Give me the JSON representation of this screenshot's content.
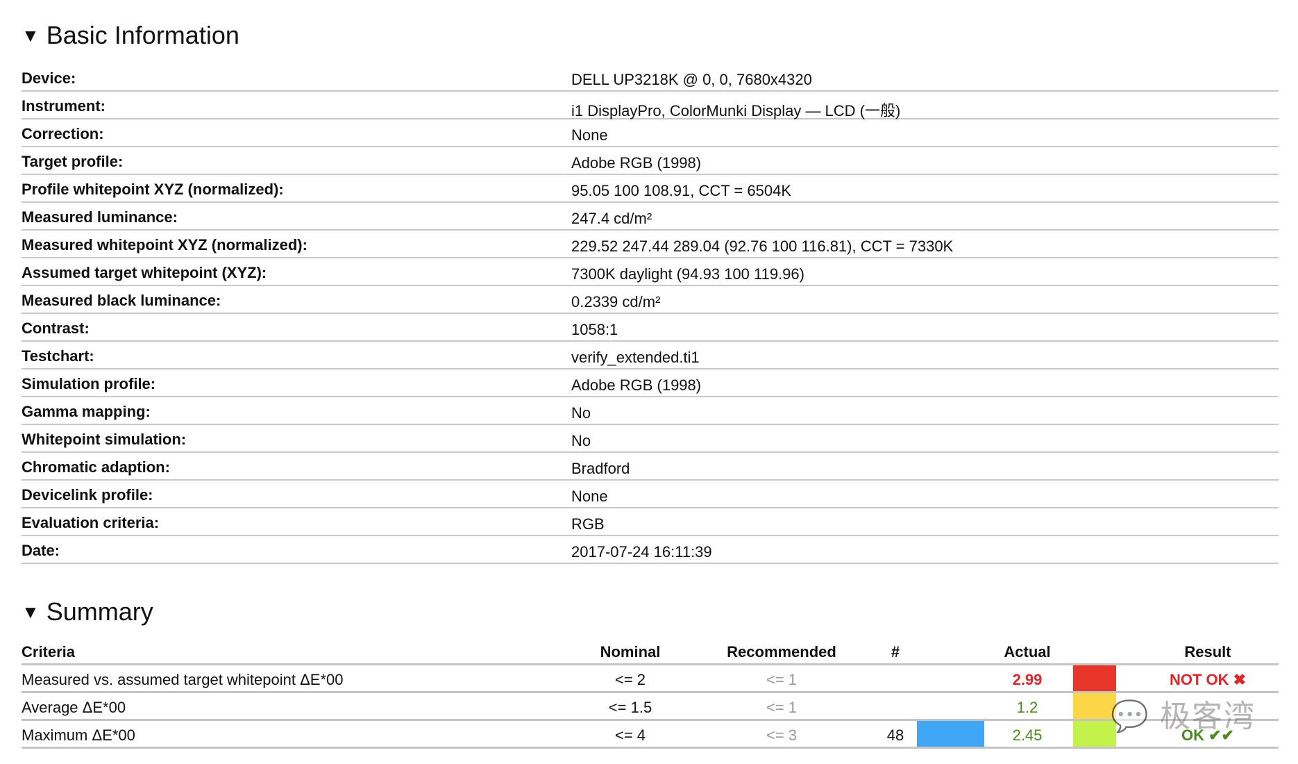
{
  "basic": {
    "title": "Basic Information",
    "rows": [
      {
        "label": "Device:",
        "value": "DELL UP3218K @ 0, 0, 7680x4320"
      },
      {
        "label": "Instrument:",
        "value": "i1 DisplayPro, ColorMunki Display — LCD (一般)"
      },
      {
        "label": "Correction:",
        "value": "None"
      },
      {
        "label": "Target profile:",
        "value": "Adobe RGB (1998)"
      },
      {
        "label": "Profile whitepoint XYZ (normalized):",
        "value": "95.05 100 108.91, CCT = 6504K"
      },
      {
        "label": "Measured luminance:",
        "value": "247.4 cd/m²"
      },
      {
        "label": "Measured whitepoint XYZ (normalized):",
        "value": "229.52 247.44 289.04 (92.76 100 116.81), CCT = 7330K"
      },
      {
        "label": "Assumed target whitepoint (XYZ):",
        "value": "7300K daylight (94.93 100 119.96)"
      },
      {
        "label": "Measured black luminance:",
        "value": "0.2339 cd/m²"
      },
      {
        "label": "Contrast:",
        "value": "1058:1"
      },
      {
        "label": "Testchart:",
        "value": "verify_extended.ti1"
      },
      {
        "label": "Simulation profile:",
        "value": "Adobe RGB (1998)"
      },
      {
        "label": "Gamma mapping:",
        "value": "No"
      },
      {
        "label": "Whitepoint simulation:",
        "value": "No"
      },
      {
        "label": "Chromatic adaption:",
        "value": "Bradford"
      },
      {
        "label": "Devicelink profile:",
        "value": "None"
      },
      {
        "label": "Evaluation criteria:",
        "value": "RGB"
      },
      {
        "label": "Date:",
        "value": "2017-07-24 16:11:39"
      }
    ]
  },
  "summary": {
    "title": "Summary",
    "headers": {
      "criteria": "Criteria",
      "nominal": "Nominal",
      "recommended": "Recommended",
      "count": "#",
      "actual": "Actual",
      "result": "Result"
    },
    "rows": [
      {
        "criteria": "Measured vs. assumed target whitepoint ΔE*00",
        "nominal": "<= 2",
        "recommended": "<= 1",
        "count": "",
        "actual": "2.99",
        "swatch": "#e8352a",
        "result": "NOT OK ✖",
        "status": "fail"
      },
      {
        "criteria": "Average ΔE*00",
        "nominal": "<= 1.5",
        "recommended": "<= 1",
        "count": "",
        "actual": "1.2",
        "swatch": "#fbd748",
        "result": "",
        "status": "ok"
      },
      {
        "criteria": "Maximum ΔE*00",
        "nominal": "<= 4",
        "recommended": "<= 3",
        "count": "48",
        "patch": "#3ea6f5",
        "actual": "2.45",
        "swatch": "#c3f34b",
        "result": "OK ✔✔",
        "status": "ok"
      }
    ]
  },
  "watermark": "极客湾",
  "colors": {
    "ok": "#4a8a1c",
    "fail": "#e0262a",
    "divider": "#c8c8c8"
  }
}
